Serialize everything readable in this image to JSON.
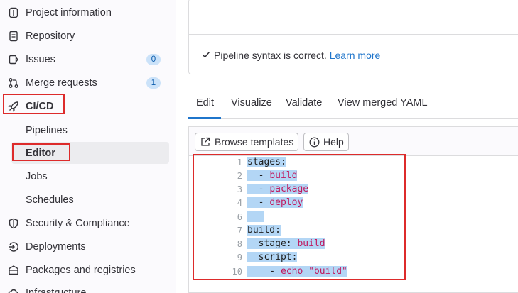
{
  "sidebar": {
    "items": [
      {
        "label": "Project information",
        "icon": "info-icon"
      },
      {
        "label": "Repository",
        "icon": "doc-icon"
      },
      {
        "label": "Issues",
        "icon": "issues-icon",
        "badge": "0"
      },
      {
        "label": "Merge requests",
        "icon": "merge-request-icon",
        "badge": "1"
      },
      {
        "label": "CI/CD",
        "icon": "rocket-icon"
      },
      {
        "label": "Pipelines"
      },
      {
        "label": "Editor"
      },
      {
        "label": "Jobs"
      },
      {
        "label": "Schedules"
      },
      {
        "label": "Security & Compliance",
        "icon": "shield-icon"
      },
      {
        "label": "Deployments",
        "icon": "deployments-icon"
      },
      {
        "label": "Packages and registries",
        "icon": "package-icon"
      },
      {
        "label": "Infrastructure",
        "icon": "cloud-icon"
      }
    ]
  },
  "validation": {
    "message": "Pipeline syntax is correct.",
    "link": "Learn more"
  },
  "tabs": [
    "Edit",
    "Visualize",
    "Validate",
    "View merged YAML"
  ],
  "toolbar": {
    "browse_label": "Browse templates",
    "help_label": "Help"
  },
  "editor": {
    "lines": [
      {
        "n": "1",
        "key": "stages:",
        "val": ""
      },
      {
        "n": "2",
        "key": "  - ",
        "val": "build"
      },
      {
        "n": "3",
        "key": "  - ",
        "val": "package"
      },
      {
        "n": "4",
        "key": "  - ",
        "val": "deploy"
      },
      {
        "n": "6",
        "key": "",
        "val": ""
      },
      {
        "n": "7",
        "key": "build:",
        "val": ""
      },
      {
        "n": "8",
        "key": "  stage: ",
        "val": "build"
      },
      {
        "n": "9",
        "key": "  script:",
        "val": ""
      },
      {
        "n": "10",
        "key": "    - ",
        "val": "echo \"build\""
      }
    ]
  },
  "colors": {
    "accent": "#1f75cb",
    "highlight_box": "#dd2b2b",
    "selection": "#b3d6f5",
    "yaml_value": "#c0185e"
  }
}
